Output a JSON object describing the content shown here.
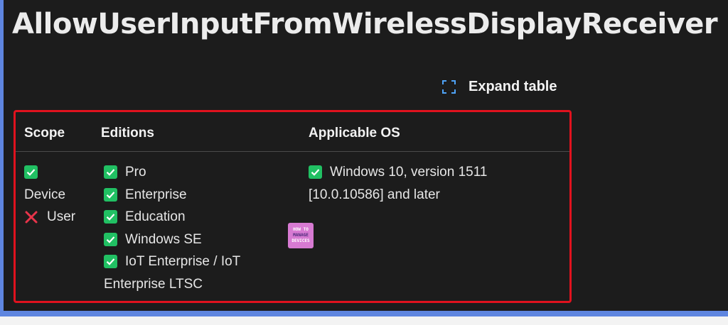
{
  "page": {
    "title": "AllowUserInputFromWirelessDisplayReceiver",
    "expand_label": "Expand table"
  },
  "table": {
    "headers": {
      "scope": "Scope",
      "editions": "Editions",
      "os": "Applicable OS"
    },
    "scope": {
      "device": "Device",
      "user": "User"
    },
    "editions": [
      "Pro",
      "Enterprise",
      "Education",
      "Windows SE",
      "IoT Enterprise / IoT"
    ],
    "editions_wrap": "Enterprise LTSC",
    "os": {
      "line1": "Windows 10, version 1511",
      "line2": "[10.0.10586] and later"
    }
  },
  "logo": {
    "line1": "HOW TO",
    "line2": "MANAGE",
    "line3": "DEVICES"
  },
  "colors": {
    "panel": "#1c1c1c",
    "frame": "#5f86e0",
    "highlight_border": "#e0121e",
    "check": "#21c063",
    "cross": "#e8344a",
    "expand_icon": "#4fa3f7"
  }
}
